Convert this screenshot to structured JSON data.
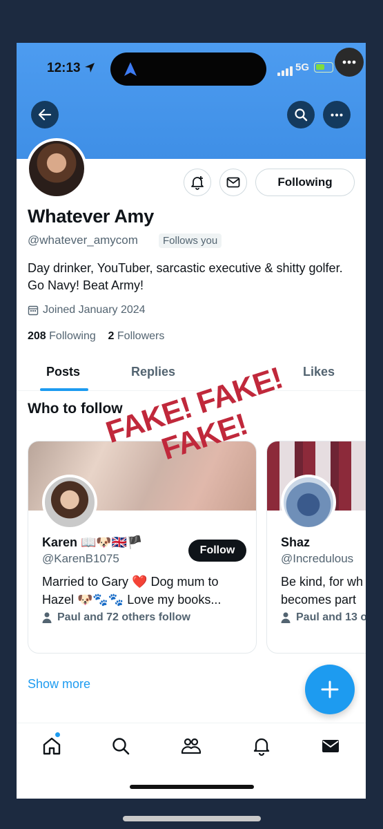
{
  "status_bar": {
    "time": "12:13",
    "network": "5G"
  },
  "profile": {
    "name": "Whatever Amy",
    "handle": "@whatever_amycom",
    "follows_you": "Follows you",
    "bio": "Day drinker, YouTuber, sarcastic executive & shitty golfer. Go Navy! Beat Army!",
    "joined": "Joined January 2024",
    "following_count": "208",
    "following_label": "Following",
    "followers_count": "2",
    "followers_label": "Followers"
  },
  "actions": {
    "following_button": "Following"
  },
  "tabs": [
    {
      "label": "Posts",
      "active": true
    },
    {
      "label": "Replies",
      "active": false
    },
    {
      "label": "Likes",
      "active": false
    }
  ],
  "who_to_follow": {
    "title": "Who to follow",
    "cards": [
      {
        "name": "Karen 📖🐶🇬🇧🏴",
        "handle": "@KarenB1075",
        "bio": "Married to Gary ❤️ Dog mum to Hazel 🐶🐾🐾 Love my books...",
        "social": "Paul and 72 others follow",
        "follow_label": "Follow"
      },
      {
        "name": "Shaz",
        "handle": "@Incredulous",
        "bio": "Be kind, for wh becomes part",
        "social": "Paul and 13 o"
      }
    ]
  },
  "show_more": "Show more",
  "overlay": {
    "stamp_line1": "FAKE! FAKE!",
    "stamp_line2": "FAKE!"
  },
  "colors": {
    "accent": "#1d9bf0",
    "banner": "#4d9cf0",
    "stamp": "#c0283b",
    "frame": "#1c2a40"
  }
}
